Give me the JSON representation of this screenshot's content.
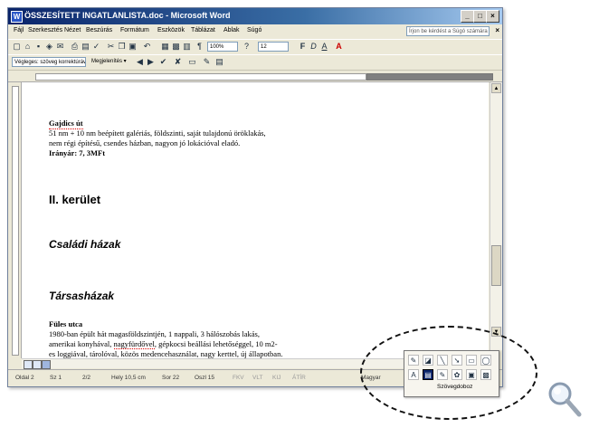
{
  "window": {
    "title": "ÖSSZESÍTETT INGATLANLISTA.doc - Microsoft Word",
    "icon_letter": "W",
    "controls": [
      "_",
      "□",
      "×"
    ]
  },
  "menubar": {
    "items": [
      "Fájl",
      "Szerkesztés",
      "Nézet",
      "Beszúrás",
      "Formátum",
      "Eszközök",
      "Táblázat",
      "Ablak",
      "Súgó"
    ],
    "ask_placeholder": "Írjon be kérdést a Súgó számára",
    "close_doc": "×"
  },
  "toolbar_standard": {
    "zoom": "100%",
    "font_size": "12",
    "icons": [
      "new-icon",
      "open-icon",
      "save-icon",
      "permission-icon",
      "email-icon",
      "print-icon",
      "print-preview-icon",
      "spelling-icon",
      "cut-icon",
      "copy-icon",
      "paste-icon",
      "undo-icon",
      "table-icon",
      "excel-icon",
      "columns-icon",
      "paragraph-icon",
      "help-icon",
      "bold-icon",
      "italic-icon",
      "underline-icon",
      "font-color-icon"
    ]
  },
  "toolbar_review": {
    "display_combo": "Végleges: szöveg korrektúrával",
    "show_label": "Megjelenítés ▾"
  },
  "document": {
    "para1_title": "Gajdics út",
    "para1_line1": "51 nm + 10 nm beépített galériás, földszinti, saját tulajdonú öröklakás,",
    "para1_line2": "nem régi építésű, csendes házban, nagyon jó lokációval eladó.",
    "para1_line3": "Irányár: 7, 3MFt",
    "heading_district": "II. kerület",
    "heading_family": "Családi házak",
    "heading_terraced": "Társasházak",
    "para2_title": "Füles utca",
    "para2_line1": "1980-ban épült hát magasföldszintjén, 1 nappali, 3 hálószobás lakás,",
    "para2_line2a": "amerikai konyhával, ",
    "para2_line2b": "nagyfürdővel",
    "para2_line2c": ", gépkocsi beállási lehetőséggel, 10 m2-",
    "para2_line3": "es loggiával, tárolóval, közös medencehasználat, nagy kerttel, új állapotban."
  },
  "statusbar": {
    "page": "Oldal 2",
    "section": "Sz 1",
    "pages": "2/2",
    "position": "Hely 10,5 cm",
    "line": "Sor 22",
    "column": "Oszl 15",
    "rec": "FKV",
    "trk": "VLT",
    "ext": "KIJ",
    "ovr": "ÁTÍR",
    "language": "Magyar"
  },
  "popup": {
    "label": "Szövegdoboz",
    "icons": [
      "draw-icon",
      "autoshapes-icon",
      "line-icon",
      "arrow-icon",
      "rectangle-icon",
      "oval-icon",
      "textbox-icon",
      "wordart-icon",
      "diagram-icon",
      "clipart-icon",
      "picture-icon",
      "fill-color-icon"
    ]
  }
}
